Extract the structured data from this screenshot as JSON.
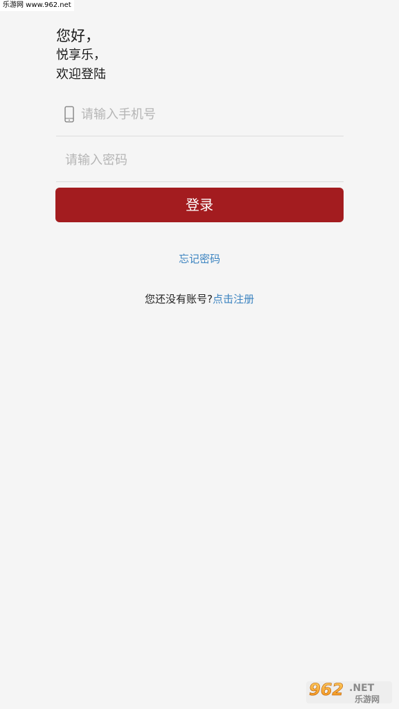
{
  "watermark": {
    "text": "乐游网 www.962.net"
  },
  "greeting": {
    "line1": "您好，",
    "line2": "悦享乐，",
    "line3": "欢迎登陆"
  },
  "form": {
    "phone_placeholder": "请输入手机号",
    "password_placeholder": "请输入密码",
    "login_label": "登录"
  },
  "links": {
    "forgot_password": "忘记密码",
    "no_account_prompt": "您还没有账号?",
    "register": "点击注册"
  },
  "logo": {
    "number": "962",
    "suffix": ".NET",
    "subtitle": "乐游网"
  },
  "icons": {
    "phone": "phone-icon"
  },
  "colors": {
    "background": "#f5f5f5",
    "primary_button": "#a31c1f",
    "link": "#3b83c0",
    "placeholder": "#b5b5b5",
    "divider": "#dcdcdc"
  }
}
